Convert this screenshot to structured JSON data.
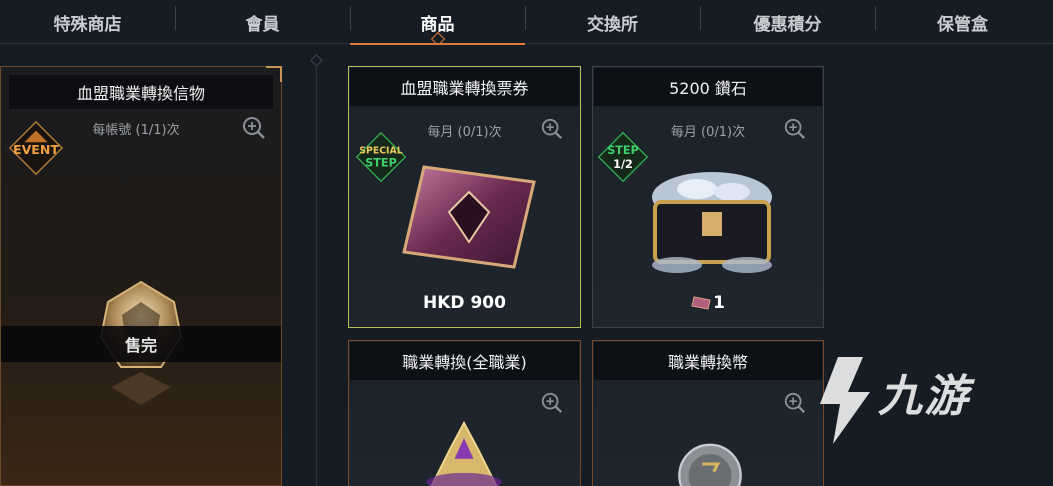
{
  "tabs": [
    {
      "label": "特殊商店"
    },
    {
      "label": "會員"
    },
    {
      "label": "商品"
    },
    {
      "label": "交換所"
    },
    {
      "label": "優惠積分"
    },
    {
      "label": "保管盒"
    }
  ],
  "active_tab": "商品",
  "event_card": {
    "title": "血盟職業轉換信物",
    "limit": "每帳號 (1/1)次",
    "badge": "EVENT",
    "status": "售完"
  },
  "products": [
    {
      "title": "血盟職業轉換票券",
      "limit": "每月 (0/1)次",
      "badge_top": "SPECIAL",
      "badge_bottom": "STEP",
      "price": "HKD 900"
    },
    {
      "title": "5200 鑽石",
      "limit": "每月 (0/1)次",
      "badge_top": "STEP",
      "badge_bottom": "1/2",
      "cost": "1"
    },
    {
      "title": "職業轉換(全職業)"
    },
    {
      "title": "職業轉換幣"
    }
  ],
  "watermark": {
    "text": "九游"
  },
  "colors": {
    "accent": "#e07a3a",
    "selected_border": "#b4bf58",
    "badge_green": "#2fa84f",
    "event_orange": "#e8892e"
  }
}
